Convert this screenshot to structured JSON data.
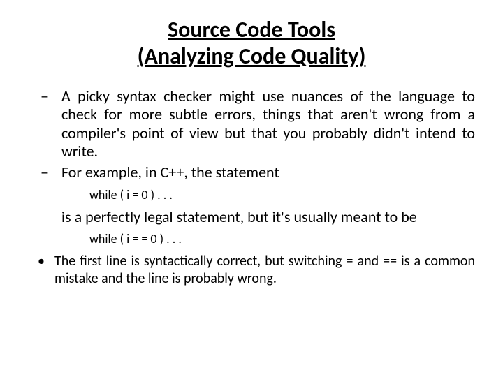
{
  "title_line1": "Source Code Tools",
  "title_line2": "(Analyzing Code Quality)",
  "items": [
    {
      "marker": "–",
      "text": "A picky syntax checker might use nuances of the language to check for more subtle errors, things that aren't wrong from a compiler's point of view but that you probably didn't intend to write."
    },
    {
      "marker": "–",
      "text": "For example, in C++, the statement"
    }
  ],
  "code1": "while ( i = 0 ) . . .",
  "followup1": "is a perfectly legal statement, but it's usually meant to be",
  "code2": "while ( i = = 0 ) . . .",
  "dot": {
    "marker": "•",
    "text": "The first line is syntactically correct, but switching = and == is a common mistake and the line is probably wrong."
  }
}
